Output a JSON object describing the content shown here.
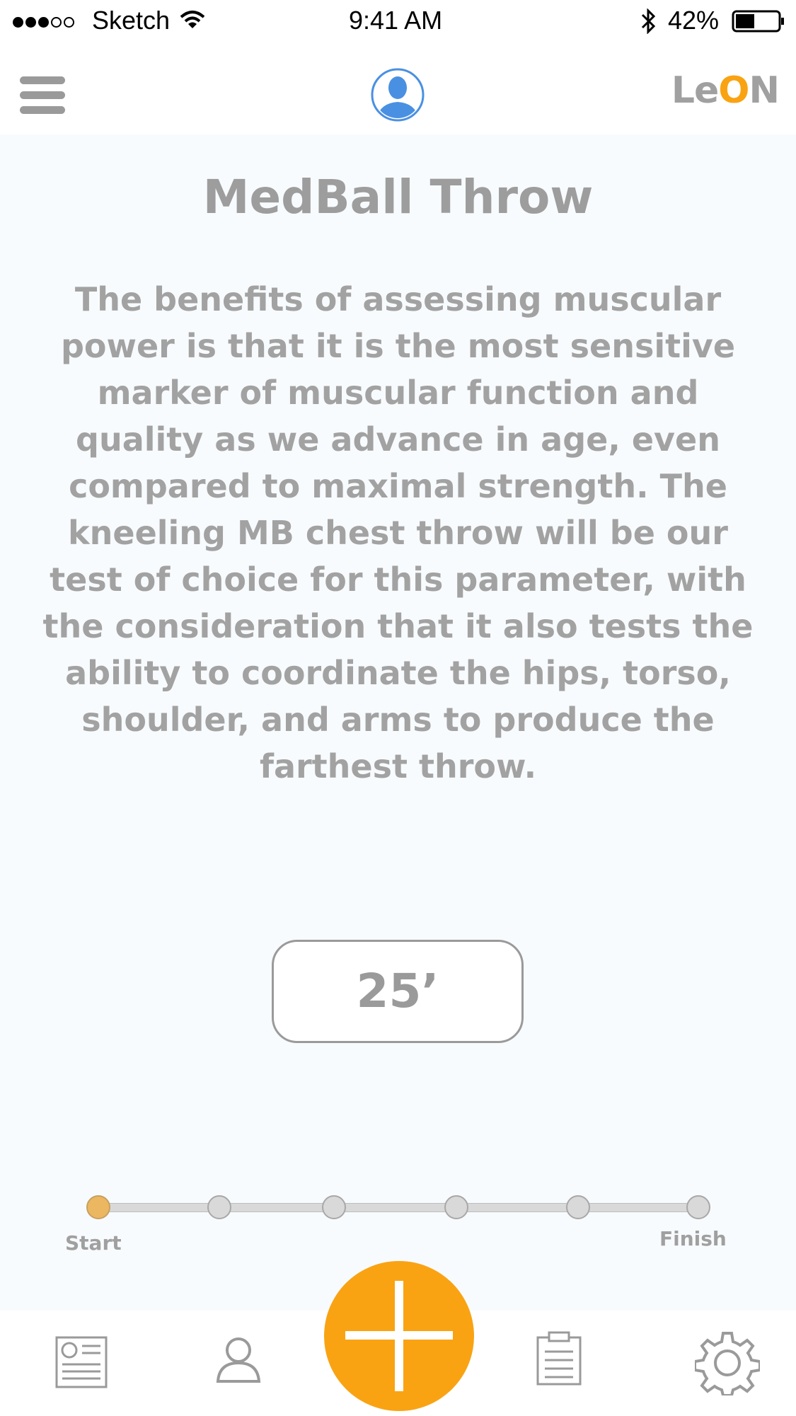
{
  "status_bar": {
    "carrier": "Sketch",
    "time": "9:41 AM",
    "battery": "42%",
    "signal_full_dots": 3,
    "signal_empty_dots": 2
  },
  "header": {
    "menu_icon": "hamburger-icon",
    "profile_icon": "user-avatar-icon",
    "logo": "LeON"
  },
  "content": {
    "title": "MedBall Throw",
    "description": "The benefits of assessing muscular power is that it is the most sensitive marker of muscular function and quality as we advance in age, even compared to maximal strength. The kneeling MB chest throw will be our test of choice for this parameter, with the consideration that it also tests the ability to coordinate the hips, torso, shoulder, and arms to produce the farthest throw.",
    "result_value": "25’"
  },
  "progress": {
    "total_steps": 6,
    "current_step": 1,
    "start_label": "Start",
    "finish_label": "Finish"
  },
  "tab_bar": {
    "items": [
      "news-icon",
      "profile-icon",
      "add-icon",
      "clipboard-icon",
      "settings-icon"
    ]
  },
  "colors": {
    "accent": "#f9a313",
    "text": "#a2a2a2",
    "avatar": "#4a90e2",
    "active_step": "#ebb761"
  }
}
